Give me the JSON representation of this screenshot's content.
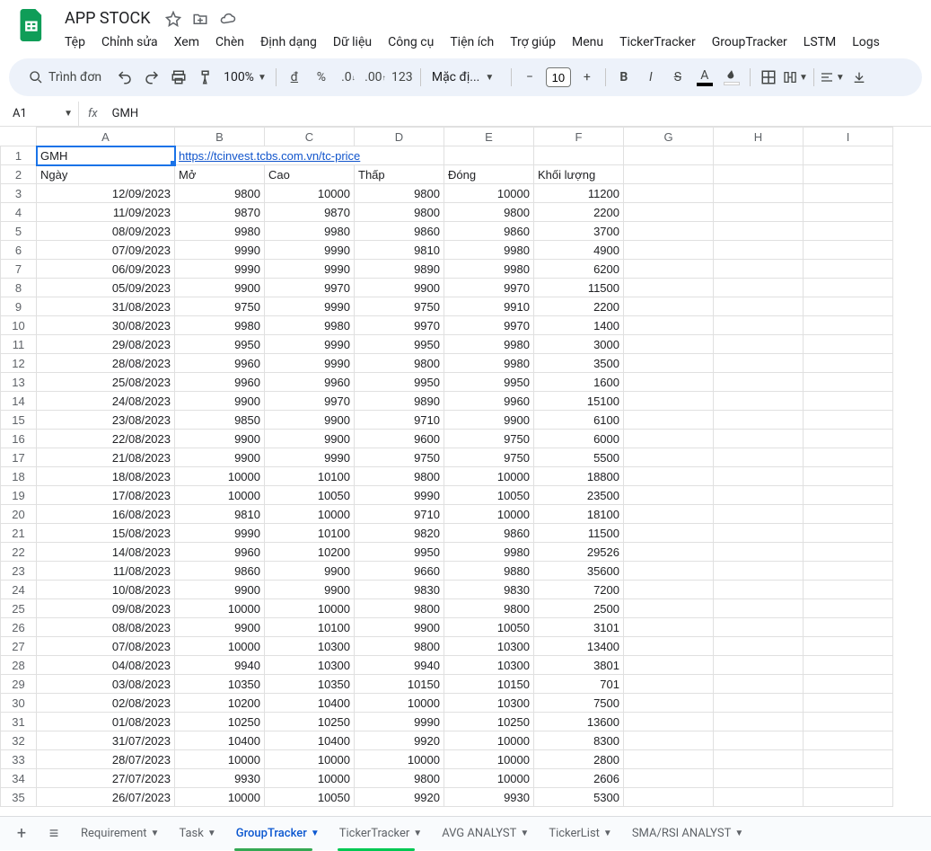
{
  "doc": {
    "title": "APP STOCK"
  },
  "menu": [
    "Tệp",
    "Chỉnh sửa",
    "Xem",
    "Chèn",
    "Định dạng",
    "Dữ liệu",
    "Công cụ",
    "Tiện ích",
    "Trợ giúp",
    "Menu",
    "TickerTracker",
    "GroupTracker",
    "LSTM",
    "Logs"
  ],
  "toolbar": {
    "search_label": "Trình đơn",
    "zoom": "100%",
    "font": "Mặc đị...",
    "font_size": "10"
  },
  "formula": {
    "namebox": "A1",
    "value": "GMH"
  },
  "columns": [
    "A",
    "B",
    "C",
    "D",
    "E",
    "F",
    "G",
    "H",
    "I"
  ],
  "headers": {
    "r1": {
      "a": "GMH",
      "b": "https://tcinvest.tcbs.com.vn/tc-price"
    },
    "r2": [
      "Ngày",
      "Mở",
      "Cao",
      "Thấp",
      "Đóng",
      "Khối lượng"
    ]
  },
  "rows": [
    [
      "12/09/2023",
      "9800",
      "10000",
      "9800",
      "10000",
      "11200"
    ],
    [
      "11/09/2023",
      "9870",
      "9870",
      "9800",
      "9800",
      "2200"
    ],
    [
      "08/09/2023",
      "9980",
      "9980",
      "9860",
      "9860",
      "3700"
    ],
    [
      "07/09/2023",
      "9990",
      "9990",
      "9810",
      "9980",
      "4900"
    ],
    [
      "06/09/2023",
      "9990",
      "9990",
      "9890",
      "9980",
      "6200"
    ],
    [
      "05/09/2023",
      "9900",
      "9970",
      "9900",
      "9970",
      "11500"
    ],
    [
      "31/08/2023",
      "9750",
      "9990",
      "9750",
      "9910",
      "2200"
    ],
    [
      "30/08/2023",
      "9980",
      "9980",
      "9970",
      "9970",
      "1400"
    ],
    [
      "29/08/2023",
      "9950",
      "9990",
      "9950",
      "9980",
      "3000"
    ],
    [
      "28/08/2023",
      "9960",
      "9990",
      "9800",
      "9980",
      "3500"
    ],
    [
      "25/08/2023",
      "9960",
      "9960",
      "9950",
      "9950",
      "1600"
    ],
    [
      "24/08/2023",
      "9900",
      "9970",
      "9890",
      "9960",
      "15100"
    ],
    [
      "23/08/2023",
      "9850",
      "9900",
      "9710",
      "9900",
      "6100"
    ],
    [
      "22/08/2023",
      "9900",
      "9900",
      "9600",
      "9750",
      "6000"
    ],
    [
      "21/08/2023",
      "9900",
      "9990",
      "9750",
      "9750",
      "5500"
    ],
    [
      "18/08/2023",
      "10000",
      "10100",
      "9800",
      "10000",
      "18800"
    ],
    [
      "17/08/2023",
      "10000",
      "10050",
      "9990",
      "10050",
      "23500"
    ],
    [
      "16/08/2023",
      "9810",
      "10000",
      "9710",
      "10000",
      "18100"
    ],
    [
      "15/08/2023",
      "9990",
      "10100",
      "9820",
      "9860",
      "11500"
    ],
    [
      "14/08/2023",
      "9960",
      "10200",
      "9950",
      "9980",
      "29526"
    ],
    [
      "11/08/2023",
      "9860",
      "9900",
      "9660",
      "9880",
      "35600"
    ],
    [
      "10/08/2023",
      "9900",
      "9900",
      "9830",
      "9830",
      "7200"
    ],
    [
      "09/08/2023",
      "10000",
      "10000",
      "9800",
      "9800",
      "2500"
    ],
    [
      "08/08/2023",
      "9900",
      "10100",
      "9900",
      "10050",
      "3101"
    ],
    [
      "07/08/2023",
      "10000",
      "10300",
      "9800",
      "10300",
      "13400"
    ],
    [
      "04/08/2023",
      "9940",
      "10300",
      "9940",
      "10300",
      "3801"
    ],
    [
      "03/08/2023",
      "10350",
      "10350",
      "10150",
      "10150",
      "701"
    ],
    [
      "02/08/2023",
      "10200",
      "10400",
      "10000",
      "10300",
      "7500"
    ],
    [
      "01/08/2023",
      "10250",
      "10250",
      "9990",
      "10250",
      "13600"
    ],
    [
      "31/07/2023",
      "10400",
      "10400",
      "9920",
      "10000",
      "8300"
    ],
    [
      "28/07/2023",
      "10000",
      "10000",
      "10000",
      "10000",
      "2800"
    ],
    [
      "27/07/2023",
      "9930",
      "10000",
      "9800",
      "10000",
      "2606"
    ],
    [
      "26/07/2023",
      "10000",
      "10050",
      "9920",
      "9930",
      "5300"
    ]
  ],
  "tabs": [
    {
      "label": "Requirement",
      "active": false
    },
    {
      "label": "Task",
      "active": false
    },
    {
      "label": "GroupTracker",
      "active": true,
      "color": "green"
    },
    {
      "label": "TickerTracker",
      "active": false,
      "color": "mint"
    },
    {
      "label": "AVG ANALYST",
      "active": false
    },
    {
      "label": "TickerList",
      "active": false
    },
    {
      "label": "SMA/RSI ANALYST",
      "active": false
    }
  ]
}
